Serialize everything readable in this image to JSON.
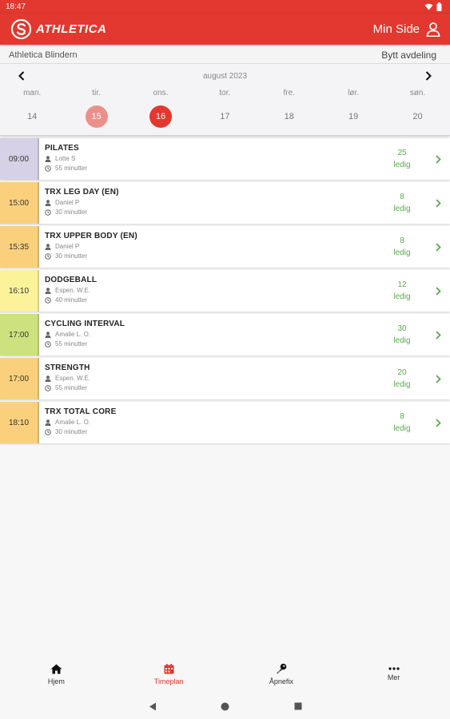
{
  "status_bar": {
    "time": "18:47"
  },
  "app_bar": {
    "brand": "ATHLETICA",
    "user_link": "Min Side"
  },
  "location": {
    "name": "Athletica Blindern",
    "switch": "Bytt avdeling"
  },
  "calendar": {
    "month": "august 2023",
    "days": [
      {
        "name": "man.",
        "num": "14",
        "state": "normal"
      },
      {
        "name": "tir.",
        "num": "15",
        "state": "prev"
      },
      {
        "name": "ons.",
        "num": "16",
        "state": "today"
      },
      {
        "name": "tor.",
        "num": "17",
        "state": "normal"
      },
      {
        "name": "fre.",
        "num": "18",
        "state": "normal"
      },
      {
        "name": "lør.",
        "num": "19",
        "state": "normal"
      },
      {
        "name": "søn.",
        "num": "20",
        "state": "normal"
      }
    ]
  },
  "classes": [
    {
      "time": "09:00",
      "name": "PILATES",
      "instructor": "Lotte S",
      "duration": "55 minutter",
      "spots": "25",
      "spots_label": "ledig",
      "color": "#d6d1e6"
    },
    {
      "time": "15:00",
      "name": "TRX LEG DAY (EN)",
      "instructor": "Daniel P",
      "duration": "30 minutter",
      "spots": "8",
      "spots_label": "ledig",
      "color": "#fbd07c"
    },
    {
      "time": "15:35",
      "name": "TRX UPPER BODY (EN)",
      "instructor": "Daniel P",
      "duration": "30 minutter",
      "spots": "8",
      "spots_label": "ledig",
      "color": "#fbd07c"
    },
    {
      "time": "16:10",
      "name": "DODGEBALL",
      "instructor": "Espen. W.E.",
      "duration": "40 minutter",
      "spots": "12",
      "spots_label": "ledig",
      "color": "#fbf29a"
    },
    {
      "time": "17:00",
      "name": "CYCLING INTERVAL",
      "instructor": "Amalie L. O.",
      "duration": "55 minutter",
      "spots": "30",
      "spots_label": "ledig",
      "color": "#cde27e"
    },
    {
      "time": "17:00",
      "name": "STRENGTH",
      "instructor": "Espen. W.E.",
      "duration": "55 minutter",
      "spots": "20",
      "spots_label": "ledig",
      "color": "#fbd07c"
    },
    {
      "time": "18:10",
      "name": "TRX TOTAL CORE",
      "instructor": "Amalie L. O.",
      "duration": "30 minutter",
      "spots": "8",
      "spots_label": "ledig",
      "color": "#fbd07c"
    }
  ],
  "bottom_nav": [
    {
      "label": "Hjem",
      "icon": "home-icon",
      "active": false
    },
    {
      "label": "Timeplan",
      "icon": "calendar-icon",
      "active": true
    },
    {
      "label": "Åpnefix",
      "icon": "key-icon",
      "active": false
    },
    {
      "label": "Mer",
      "icon": "more-icon",
      "active": false
    }
  ],
  "colors": {
    "brand": "#e2382f",
    "available": "#5ba84e",
    "prev_day": "#eb8f8a"
  }
}
